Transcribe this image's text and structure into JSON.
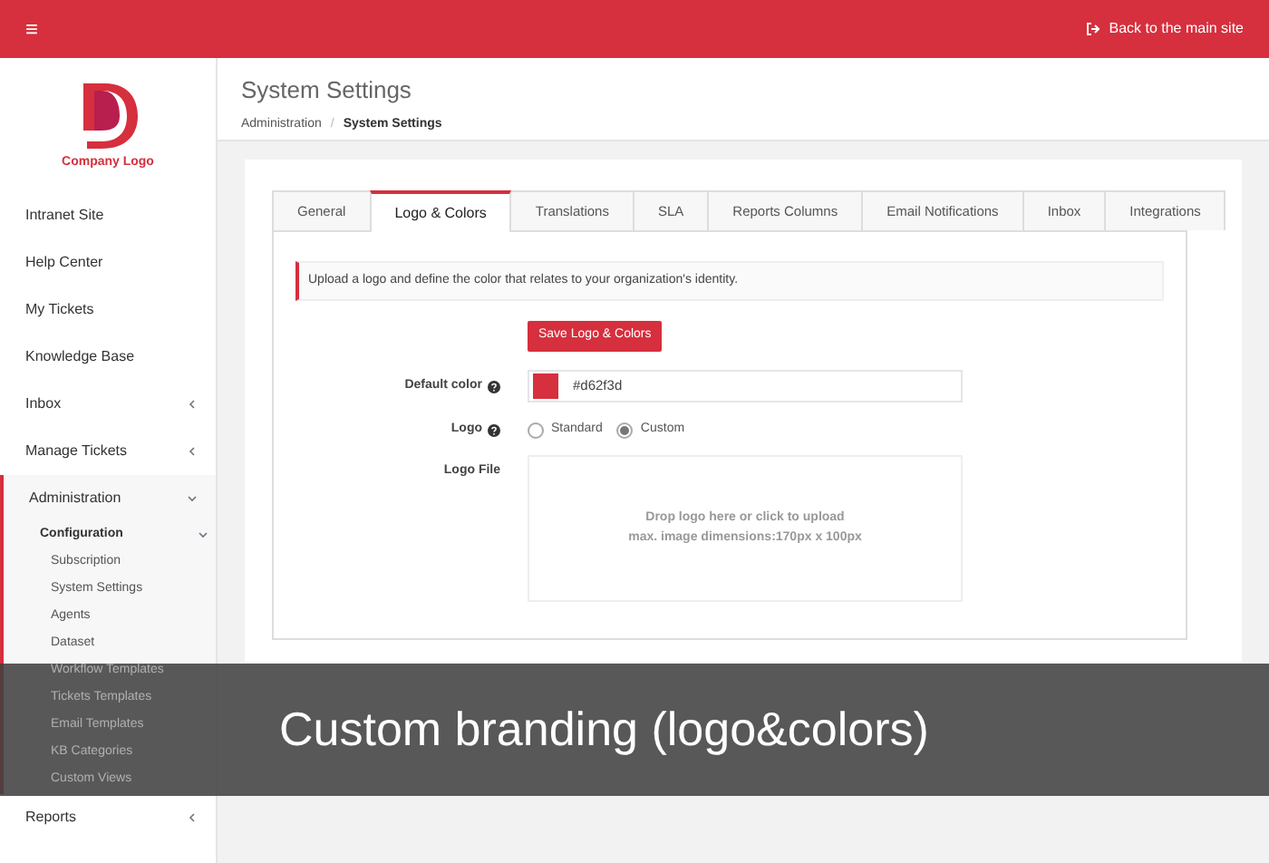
{
  "topbar": {
    "menu_icon": "≡",
    "back_link": "Back to the main site"
  },
  "sidebar": {
    "logo_text": "Company Logo",
    "items": [
      {
        "label": "Intranet Site"
      },
      {
        "label": "Help Center"
      },
      {
        "label": "My Tickets"
      },
      {
        "label": "Knowledge Base"
      },
      {
        "label": "Inbox",
        "expanded": false
      },
      {
        "label": "Manage Tickets",
        "expanded": false
      },
      {
        "label": "Administration",
        "expanded": true,
        "children": [
          {
            "label": "Configuration",
            "expanded": true,
            "children": [
              {
                "label": "Subscription"
              },
              {
                "label": "System Settings"
              },
              {
                "label": "Agents"
              },
              {
                "label": "Dataset"
              },
              {
                "label": "Workflow Templates"
              },
              {
                "label": "Tickets Templates"
              },
              {
                "label": "Email Templates"
              },
              {
                "label": "KB Categories"
              },
              {
                "label": "Custom Views"
              }
            ]
          }
        ]
      },
      {
        "label": "Reports",
        "expanded": false
      }
    ]
  },
  "header": {
    "title": "System Settings",
    "breadcrumb": [
      "Administration",
      "System Settings"
    ],
    "breadcrumb_separator": "/"
  },
  "tabs": [
    {
      "label": "General",
      "selected": false
    },
    {
      "label": "Logo & Colors",
      "selected": true
    },
    {
      "label": "Translations",
      "selected": false
    },
    {
      "label": "SLA",
      "selected": false
    },
    {
      "label": "Reports Columns",
      "selected": false
    },
    {
      "label": "Email Notifications",
      "selected": false
    },
    {
      "label": "Inbox",
      "selected": false
    },
    {
      "label": "Integrations",
      "selected": false
    }
  ],
  "info": "Upload a logo and define the color that relates to your organization's identity.",
  "save_button": "Save Logo & Colors",
  "default_color": {
    "label": "Default color",
    "value": "#d62f3d"
  },
  "logo": {
    "label": "Logo",
    "options": [
      {
        "label": "Standard",
        "selected": false
      },
      {
        "label": "Custom",
        "selected": true
      }
    ]
  },
  "logo_file": {
    "label": "Logo File",
    "dropzone": "Drop logo here or click to upload",
    "hint": "max. image dimensions:170px x 100px"
  },
  "banner": "Custom branding (logo&colors)"
}
